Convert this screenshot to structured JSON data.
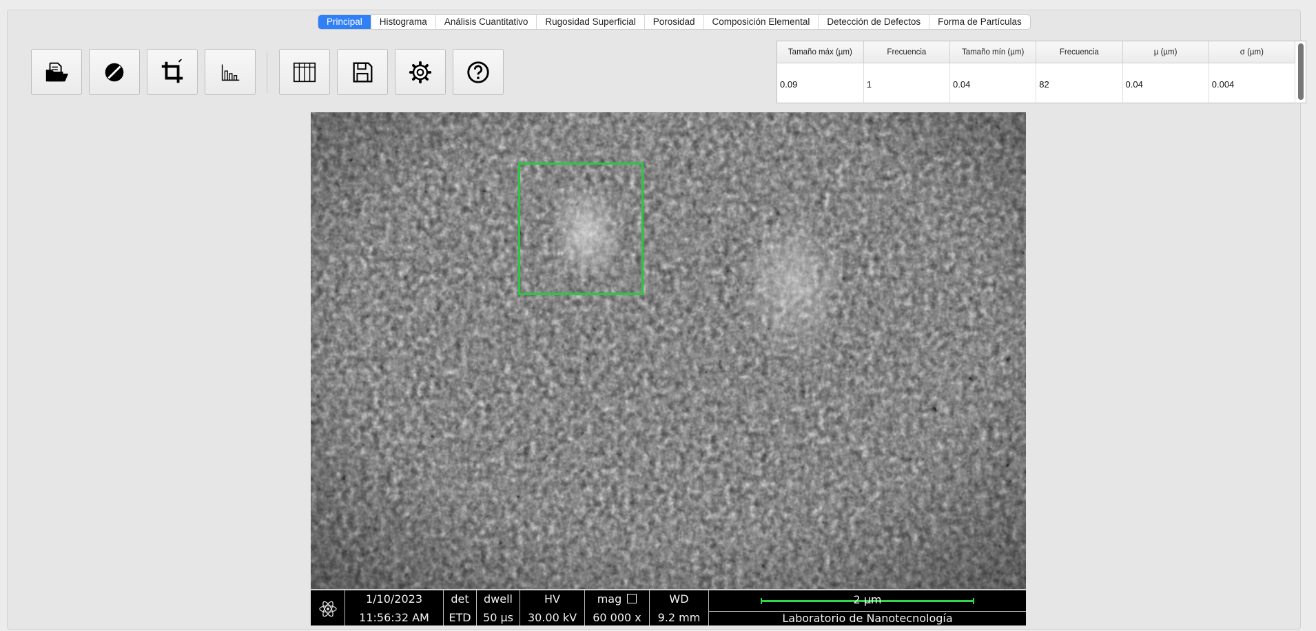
{
  "tabs": [
    {
      "label": "Principal",
      "active": true
    },
    {
      "label": "Histograma",
      "active": false
    },
    {
      "label": "Análisis Cuantitativo",
      "active": false
    },
    {
      "label": "Rugosidad Superficial",
      "active": false
    },
    {
      "label": "Porosidad",
      "active": false
    },
    {
      "label": "Composición Elemental",
      "active": false
    },
    {
      "label": "Detección de Defectos",
      "active": false
    },
    {
      "label": "Forma de Partículas",
      "active": false
    }
  ],
  "toolbar": [
    {
      "icon": "open-folder-icon"
    },
    {
      "icon": "diagonal-slash-circle-icon"
    },
    {
      "icon": "crop-icon"
    },
    {
      "icon": "bar-chart-icon"
    },
    {
      "icon": "table-icon"
    },
    {
      "icon": "save-icon"
    },
    {
      "icon": "gear-icon"
    },
    {
      "icon": "help-icon"
    }
  ],
  "stats": {
    "headers": [
      "Tamaño máx (µm)",
      "Frecuencia",
      "Tamaño mín (µm)",
      "Frecuencia",
      "µ (µm)",
      "σ (µm)"
    ],
    "row": [
      "0.09",
      "1",
      "0.04",
      "82",
      "0.04",
      "0.004"
    ]
  },
  "sem": {
    "date": "1/10/2023",
    "time": "11:56:32 AM",
    "det_label": "det",
    "det_value": "ETD",
    "dwell_label": "dwell",
    "dwell_value": "50 µs",
    "hv_label": "HV",
    "hv_value": "30.00 kV",
    "mag_label": "mag",
    "mag_value": "60 000 x",
    "wd_label": "WD",
    "wd_value": "9.2 mm",
    "scale_label": "2 µm",
    "lab_name": "Laboratorio de Nanotecnología"
  },
  "colors": {
    "accent": "#2f7ff6",
    "roi": "#27c93f",
    "scalebar": "#2ed84a"
  }
}
